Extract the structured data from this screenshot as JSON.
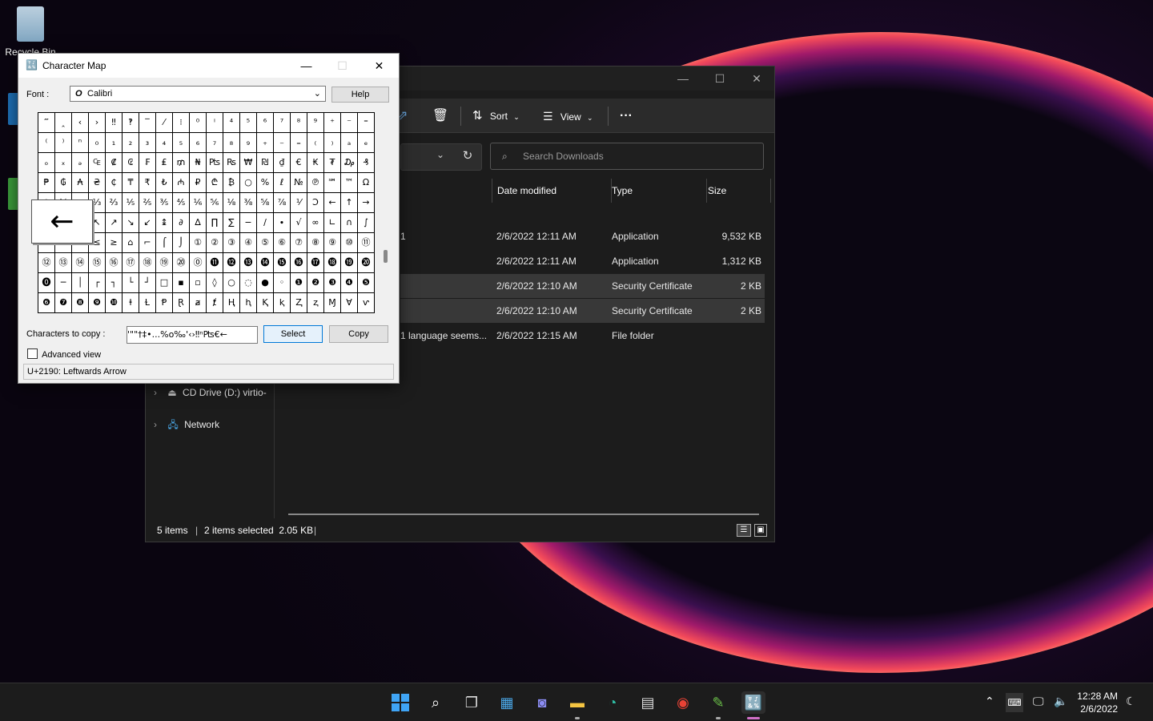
{
  "desktop": {
    "icons": [
      {
        "label": "Recycle Bin"
      }
    ]
  },
  "explorer": {
    "toolbar": {
      "sort": "Sort",
      "view": "View",
      "more": "···"
    },
    "search_placeholder": "Search Downloads",
    "columns": {
      "date": "Date modified",
      "type": "Type",
      "size": "Size"
    },
    "rows": [
      {
        "name": "1",
        "date": "2/6/2022 12:11 AM",
        "type": "Application",
        "size": "9,532 KB",
        "selected": false
      },
      {
        "name": "",
        "date": "2/6/2022 12:11 AM",
        "type": "Application",
        "size": "1,312 KB",
        "selected": false
      },
      {
        "name": "",
        "date": "2/6/2022 12:10 AM",
        "type": "Security Certificate",
        "size": "2 KB",
        "selected": true
      },
      {
        "name": "",
        "date": "2/6/2022 12:10 AM",
        "type": "Security Certificate",
        "size": "2 KB",
        "selected": true
      },
      {
        "name": "1 language seems...",
        "date": "2/6/2022 12:15 AM",
        "type": "File folder",
        "size": "",
        "selected": false
      }
    ],
    "nav": [
      {
        "label": "CD Drive (D:) virtio-"
      },
      {
        "label": "Network"
      }
    ],
    "status": {
      "items": "5 items",
      "selected": "2 items selected  2.05 KB"
    }
  },
  "charmap": {
    "title": "Character Map",
    "font_label": "Font :",
    "font_value": "Calibri",
    "help": "Help",
    "zoom_char": "←",
    "grid": [
      [
        "‴",
        "‸",
        "‹",
        "›",
        "‼",
        "‽",
        "‾",
        "⁄",
        "⁝",
        "⁰",
        "ⁱ",
        "⁴",
        "⁵",
        "⁶",
        "⁷",
        "⁸",
        "⁹",
        "⁺",
        "⁻",
        "⁼"
      ],
      [
        "⁽",
        "⁾",
        "ⁿ",
        "₀",
        "₁",
        "₂",
        "₃",
        "₄",
        "₅",
        "₆",
        "₇",
        "₈",
        "₉",
        "₊",
        "₋",
        "₌",
        "₍",
        "₎",
        "ₐ",
        "ₑ"
      ],
      [
        "ₒ",
        "ₓ",
        "ₔ",
        "₠",
        "₡",
        "₢",
        "₣",
        "₤",
        "₥",
        "₦",
        "₧",
        "₨",
        "₩",
        "₪",
        "₫",
        "€",
        "₭",
        "₮",
        "₯",
        "₰"
      ],
      [
        "₱",
        "₲",
        "₳",
        "₴",
        "₵",
        "₸",
        "₹",
        "₺",
        "₼",
        "₽",
        "₾",
        "₿",
        "○",
        "%",
        "ℓ",
        "№",
        "℗",
        "℠",
        "™",
        "Ω"
      ],
      [
        "℮",
        "⅍",
        "ⅎ",
        "⅓",
        "⅔",
        "⅕",
        "⅖",
        "⅗",
        "⅘",
        "⅙",
        "⅚",
        "⅛",
        "⅜",
        "⅝",
        "⅞",
        "⅟",
        "Ↄ",
        "←",
        "↑",
        "→"
      ],
      [
        "↓",
        "↔",
        "↕",
        "↖",
        "↗",
        "↘",
        "↙",
        "↨",
        "∂",
        "∆",
        "∏",
        "∑",
        "−",
        "∕",
        "∙",
        "√",
        "∞",
        "∟",
        "∩",
        "∫"
      ],
      [
        "≈",
        "≠",
        "≡",
        "≤",
        "≥",
        "⌂",
        "⌐",
        "⌠",
        "⌡",
        "①",
        "②",
        "③",
        "④",
        "⑤",
        "⑥",
        "⑦",
        "⑧",
        "⑨",
        "⑩",
        "⑪"
      ],
      [
        "⑫",
        "⑬",
        "⑭",
        "⑮",
        "⑯",
        "⑰",
        "⑱",
        "⑲",
        "⑳",
        "⓪",
        "⓫",
        "⓬",
        "⓭",
        "⓮",
        "⓯",
        "⓰",
        "⓱",
        "⓲",
        "⓳",
        "⓴"
      ],
      [
        "⓿",
        "─",
        "│",
        "┌",
        "┐",
        "└",
        "┘",
        "□",
        "▪",
        "▫",
        "◊",
        "○",
        "◌",
        "●",
        "◦",
        "❶",
        "❷",
        "❸",
        "❹",
        "❺"
      ],
      [
        "❻",
        "❼",
        "❽",
        "❾",
        "❿",
        "ⱡ",
        "Ɫ",
        "Ᵽ",
        "Ɽ",
        "ⱥ",
        "ⱦ",
        "Ⱨ",
        "ⱨ",
        "Ⱪ",
        "ⱪ",
        "Ⱬ",
        "ⱬ",
        "Ɱ",
        "Ɐ",
        "ⱱ"
      ]
    ],
    "chars_to_copy_label": "Characters to copy :",
    "chars_to_copy_value": "'\"\"†‡•...%o‰'‹›‼ⁿ₧€←",
    "select": "Select",
    "copy": "Copy",
    "advanced_view": "Advanced view",
    "status": "U+2190: Leftwards Arrow"
  },
  "taskbar": {
    "time": "12:28 AM",
    "date": "2/6/2022"
  }
}
